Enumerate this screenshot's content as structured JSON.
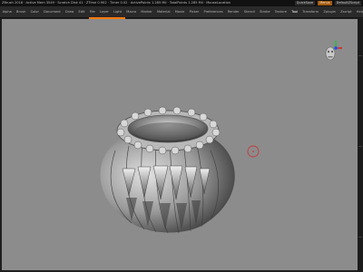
{
  "titlebar": {
    "info": "ZBrush 2018 · Active Mem 3549 · Scratch Disk 41 · ZTime 0.902 · Timer 0.02 · ActivePoints 1.285 Mil · TotalPoints 1.285 Mil · MouseLocation",
    "quicksave": "QuickSave",
    "menus": "Menus",
    "default_zscript": "DefaultZScript"
  },
  "menubar": {
    "items": [
      "Alpha",
      "Brush",
      "Color",
      "Document",
      "Draw",
      "Edit",
      "File",
      "Layer",
      "Light",
      "Macro",
      "Marker",
      "Material",
      "Movie",
      "Picker",
      "Preferences",
      "Render",
      "Stencil",
      "Stroke",
      "Texture",
      "Tool",
      "Transform",
      "Zplugin",
      "Zscript",
      "Help"
    ]
  },
  "icons": {
    "nav_head": "navigation-head-gizmo-icon",
    "brush_cursor": "brush-cursor-icon"
  },
  "colors": {
    "accent": "#ff7a0a",
    "viewport": "#8c8c8c"
  }
}
